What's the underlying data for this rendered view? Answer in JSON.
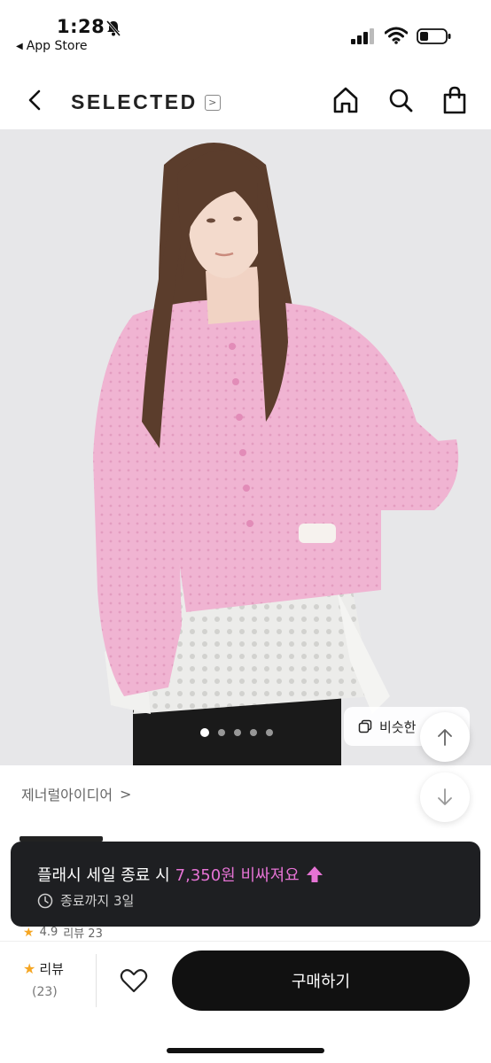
{
  "status_bar": {
    "time": "1:28",
    "back_app": "App Store"
  },
  "header": {
    "brand_name": "SELECTED",
    "brand_arrow": ">"
  },
  "gallery": {
    "dot_count": 5,
    "active_index": 0,
    "similar_label": "비슷한"
  },
  "product": {
    "brand_link": "제너럴아이디어",
    "brand_link_arrow": ">"
  },
  "flash_sale": {
    "title": "플래시 세일 종료 시",
    "accent": "7,350원 비싸져요",
    "subtitle": "종료까지 3일"
  },
  "rating_peek": {
    "score": "4.9",
    "review_label": "리뷰 23"
  },
  "bottom_bar": {
    "review_label": "리뷰",
    "review_count": "(23)",
    "buy_label": "구매하기"
  },
  "colors": {
    "accent_pink": "#e573d4",
    "star": "#f5a623",
    "banner_bg": "#1e1f22",
    "buy_button": "#111111",
    "cardigan": "#f0b4d2"
  }
}
